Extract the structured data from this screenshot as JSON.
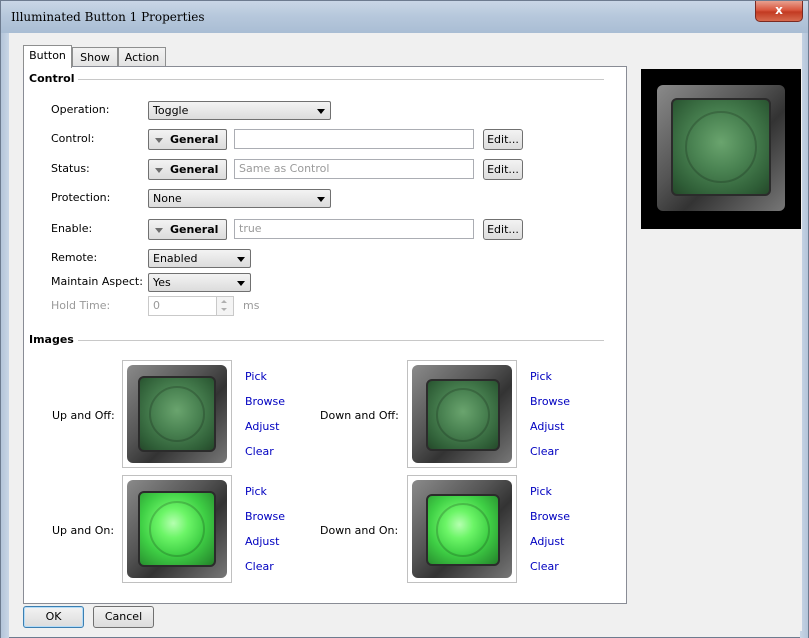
{
  "window": {
    "title": "Illuminated Button 1 Properties",
    "close_glyph": "x"
  },
  "tabs": [
    {
      "label": "Button"
    },
    {
      "label": "Show"
    },
    {
      "label": "Action"
    }
  ],
  "control_group": {
    "title": "Control",
    "operation": {
      "label": "Operation:",
      "value": "Toggle"
    },
    "control": {
      "label": "Control:",
      "source": "General",
      "value": "",
      "edit": "Edit..."
    },
    "status": {
      "label": "Status:",
      "source": "General",
      "placeholder": "Same as Control",
      "edit": "Edit..."
    },
    "protection": {
      "label": "Protection:",
      "value": "None"
    },
    "enable": {
      "label": "Enable:",
      "source": "General",
      "placeholder": "true",
      "edit": "Edit..."
    },
    "remote": {
      "label": "Remote:",
      "value": "Enabled"
    },
    "maintain_aspect": {
      "label": "Maintain Aspect:",
      "value": "Yes"
    },
    "hold_time": {
      "label": "Hold Time:",
      "value": "0",
      "unit": "ms"
    }
  },
  "images_group": {
    "title": "Images",
    "items": [
      {
        "label": "Up and Off:",
        "state": "off"
      },
      {
        "label": "Down and Off:",
        "state": "off"
      },
      {
        "label": "Up and On:",
        "state": "on"
      },
      {
        "label": "Down and On:",
        "state": "on"
      }
    ],
    "links": {
      "pick": "Pick",
      "browse": "Browse",
      "adjust": "Adjust",
      "clear": "Clear"
    }
  },
  "footer": {
    "ok": "OK",
    "cancel": "Cancel"
  }
}
